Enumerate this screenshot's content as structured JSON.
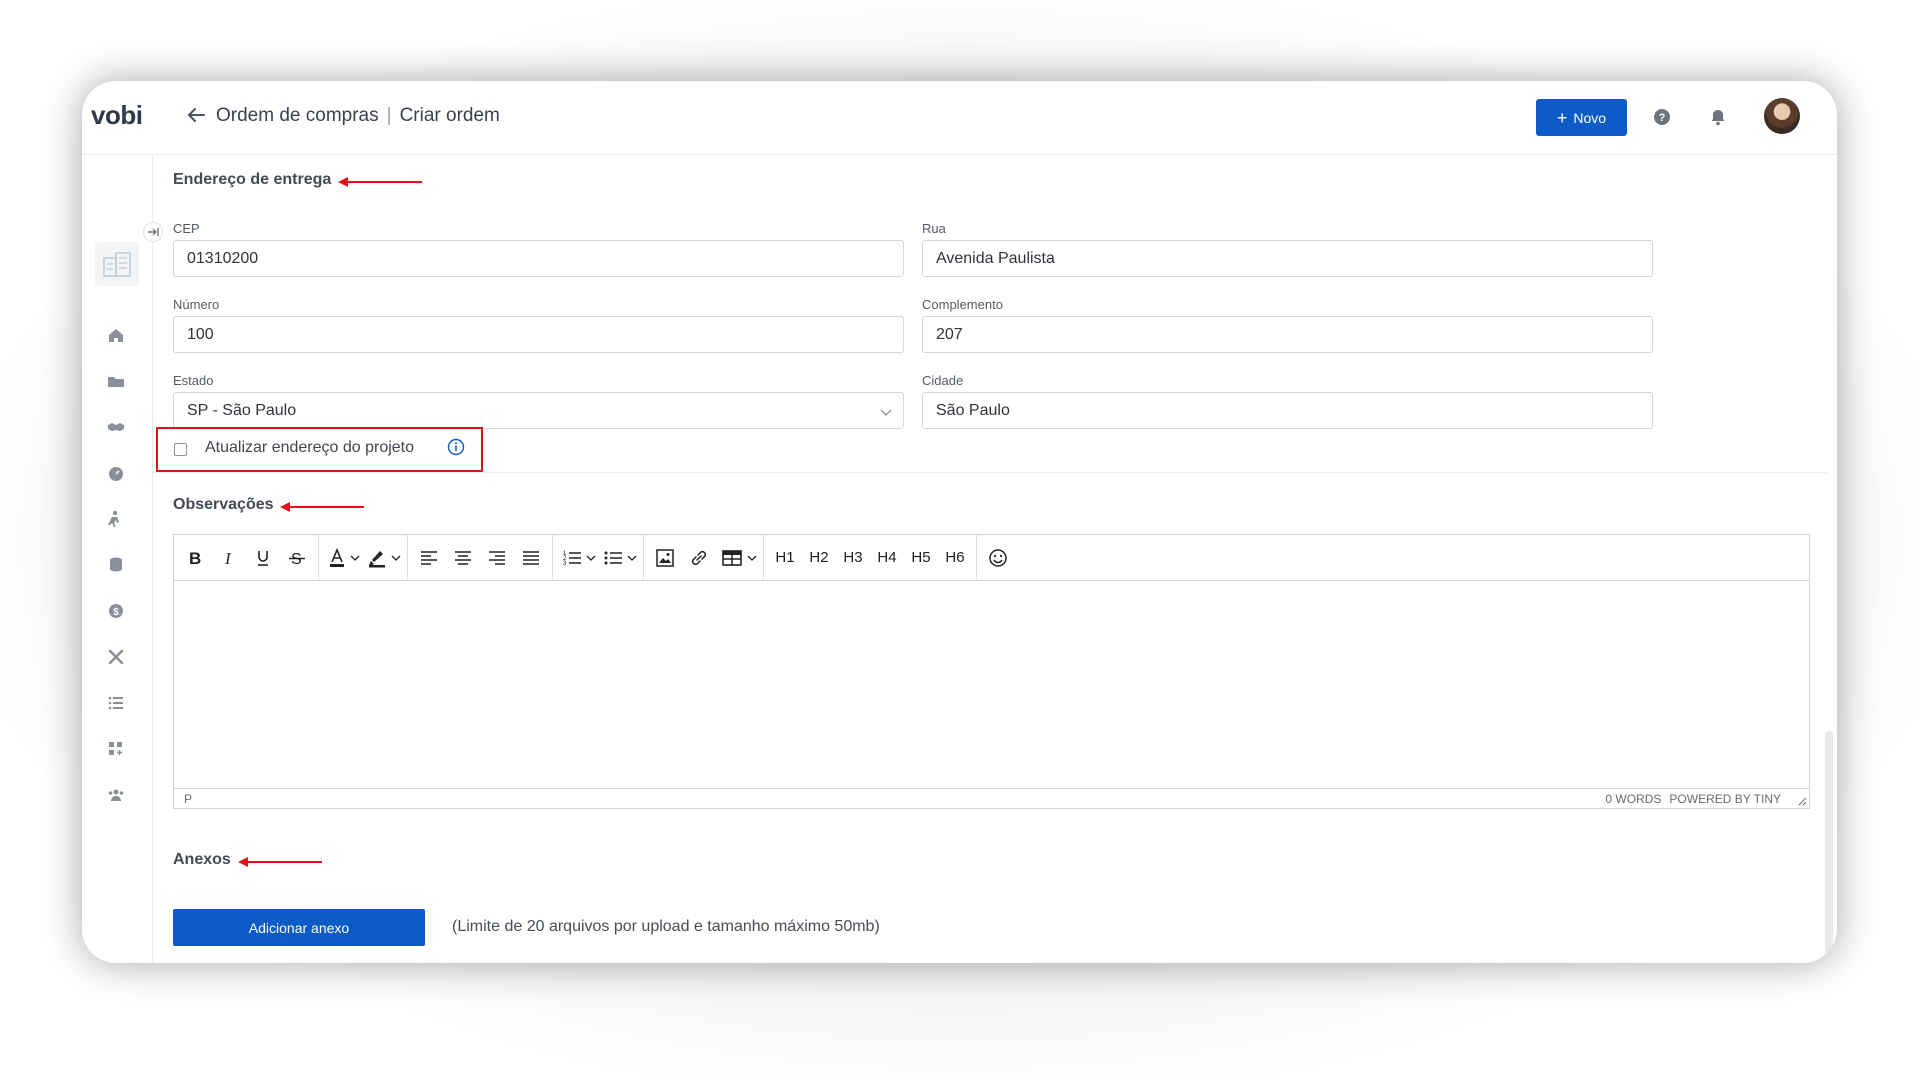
{
  "app": {
    "logo": "vobi"
  },
  "header": {
    "breadcrumb_parent": "Ordem de compras",
    "breadcrumb_separator": "|",
    "breadcrumb_current": "Criar ordem",
    "new_button_plus": "+",
    "new_button_label": "Novo"
  },
  "delivery": {
    "title": "Endereço de entrega",
    "cep": {
      "label": "CEP",
      "value": "01310200"
    },
    "rua": {
      "label": "Rua",
      "value": "Avenida Paulista"
    },
    "numero": {
      "label": "Número",
      "value": "100"
    },
    "complemento": {
      "label": "Complemento",
      "value": "207"
    },
    "estado": {
      "label": "Estado",
      "value": "SP - São Paulo"
    },
    "cidade": {
      "label": "Cidade",
      "value": "São Paulo"
    },
    "update_project_label": "Atualizar endereço do projeto"
  },
  "notes": {
    "title": "Observações",
    "toolbar": {
      "h1": "H1",
      "h2": "H2",
      "h3": "H3",
      "h4": "H4",
      "h5": "H5",
      "h6": "H6"
    },
    "status_path": "P",
    "word_count": "0 WORDS",
    "powered_by": "POWERED BY TINY"
  },
  "attachments": {
    "title": "Anexos",
    "add_button": "Adicionar anexo",
    "hint": "(Limite de 20 arquivos por upload e tamanho máximo 50mb)"
  },
  "colors": {
    "primary": "#0d5bc6",
    "annotation_red": "#e0111a"
  }
}
